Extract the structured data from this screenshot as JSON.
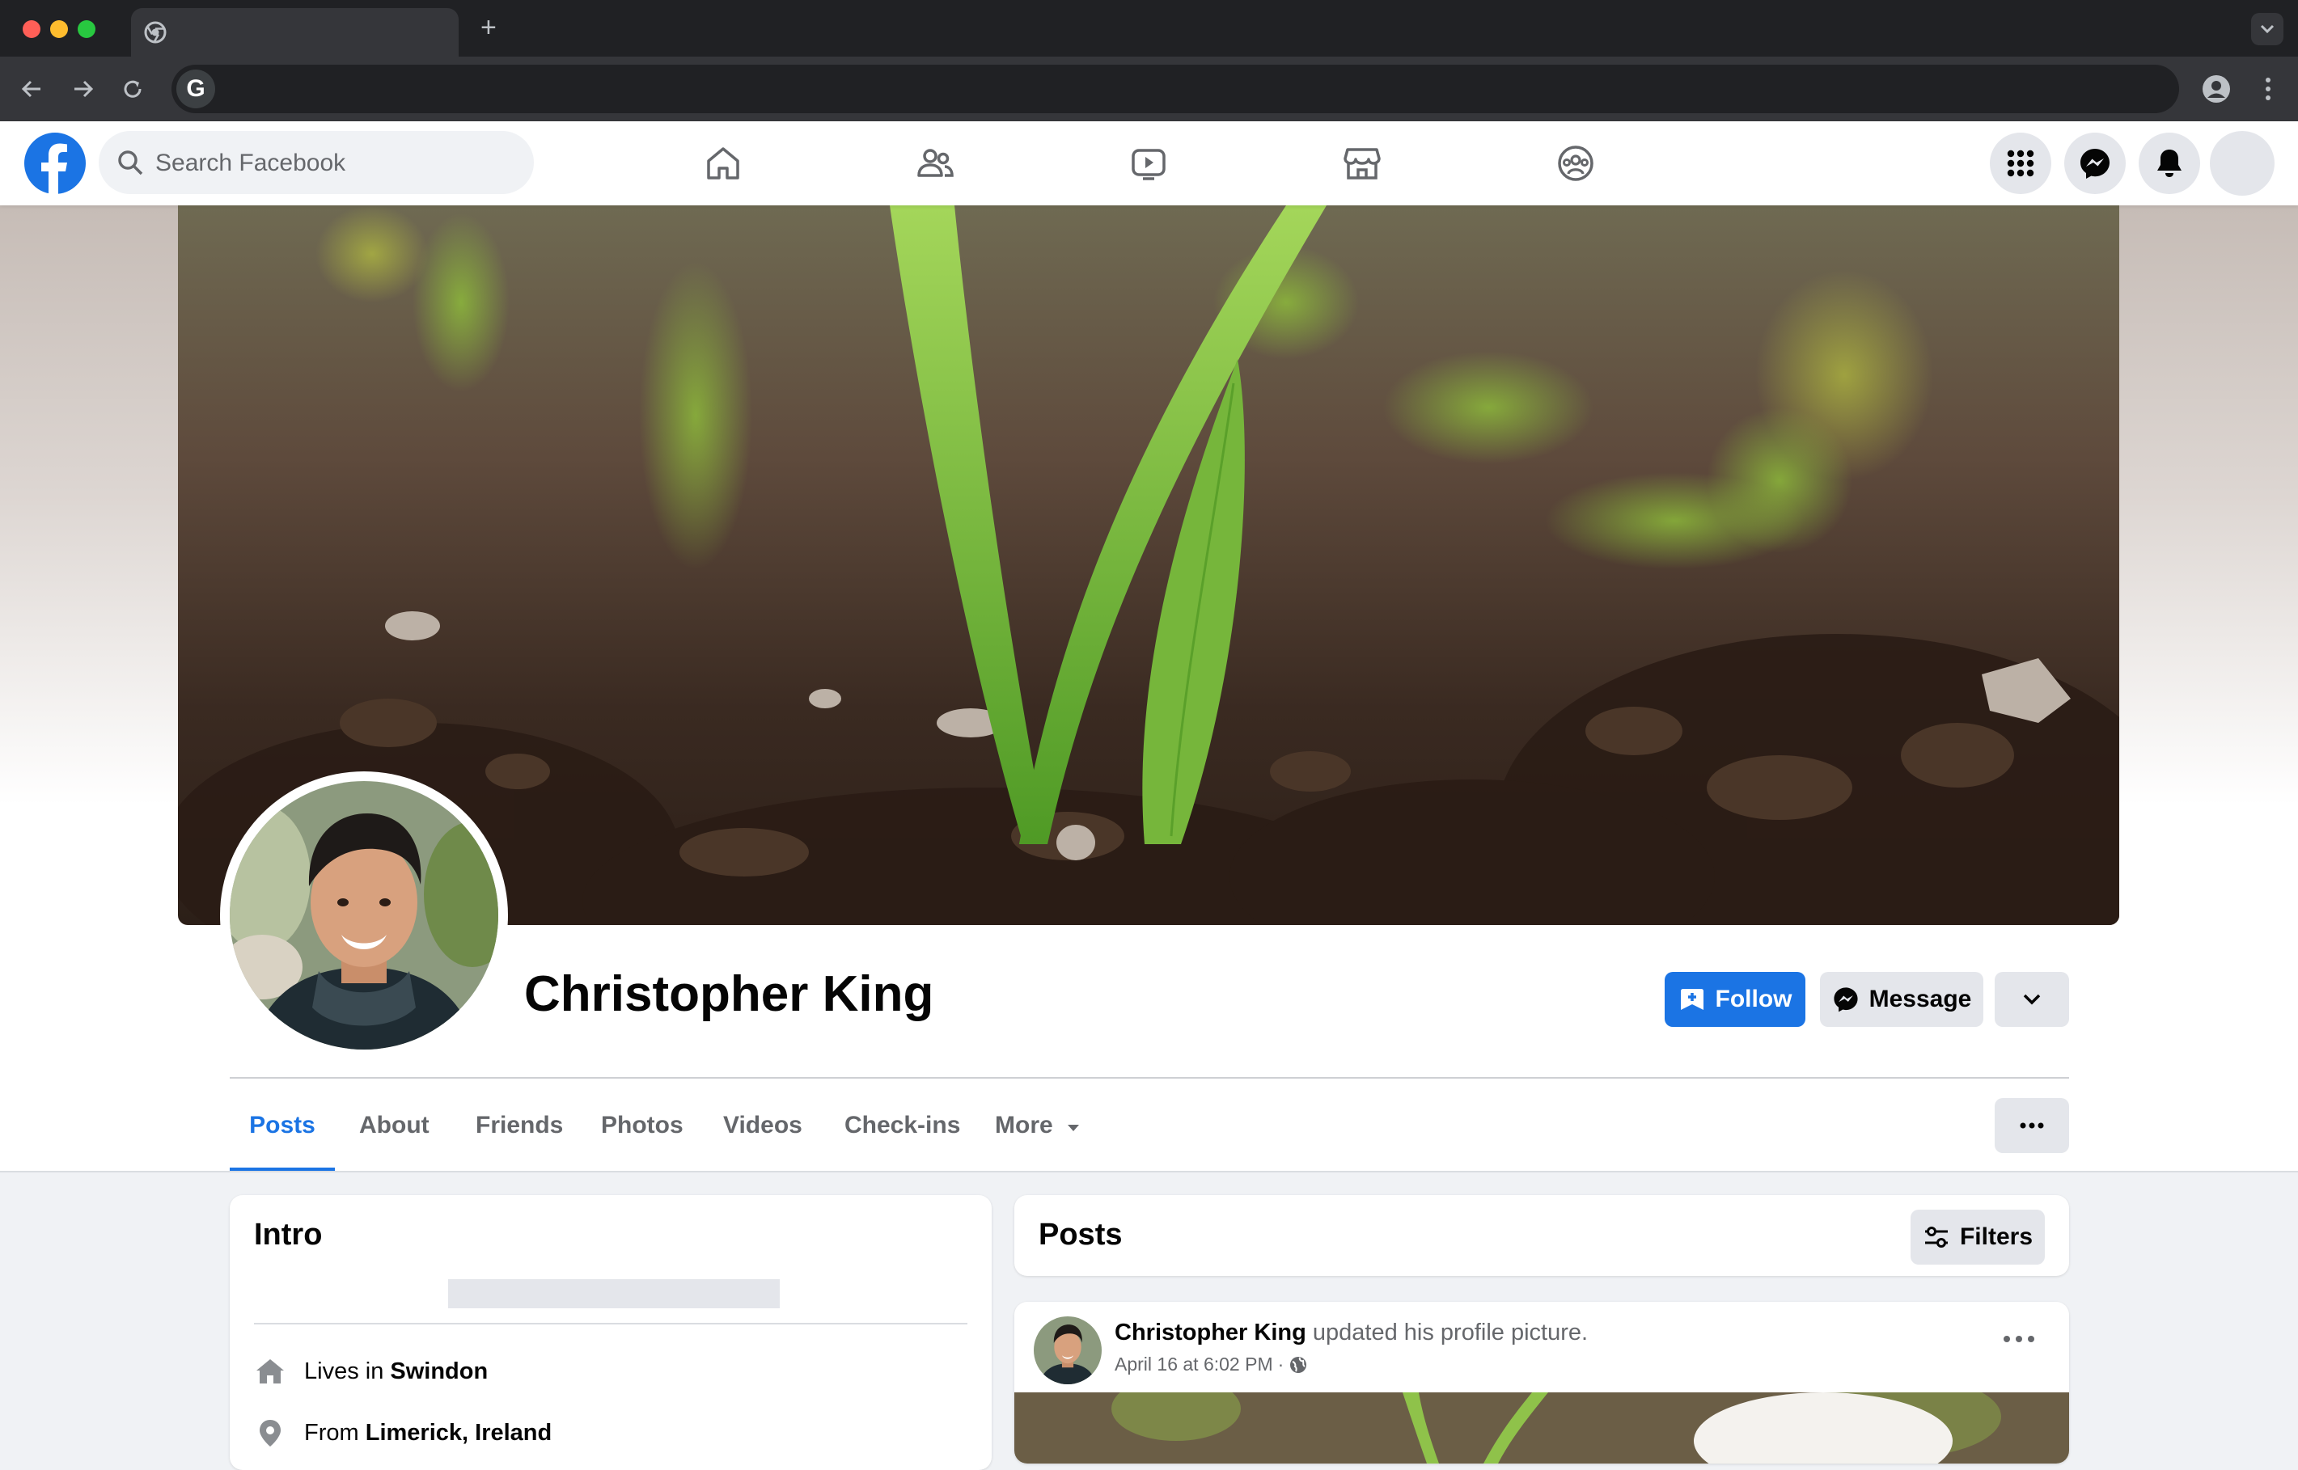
{
  "colors": {
    "brand": "#1b74e4",
    "chrome_dark": "#202124",
    "chrome_bar": "#35363a",
    "traffic_close": "#ff5f57",
    "traffic_min": "#febc2e",
    "traffic_max": "#28c840"
  },
  "browser": {
    "omnibox_badge": "G",
    "icons": [
      "chrome-icon",
      "plus-icon",
      "chevron-down-icon",
      "back-icon",
      "forward-icon",
      "reload-icon",
      "account-icon",
      "kebab-icon"
    ]
  },
  "header": {
    "search_placeholder": "Search Facebook",
    "nav_icons": [
      "home-icon",
      "friends-icon",
      "watch-icon",
      "marketplace-icon",
      "groups-icon"
    ],
    "right_icons": [
      "menu-grid-icon",
      "messenger-icon",
      "bell-icon",
      "avatar"
    ]
  },
  "profile": {
    "name": "Christopher King",
    "follow_label": "Follow",
    "message_label": "Message"
  },
  "tabs": [
    {
      "label": "Posts",
      "active": true
    },
    {
      "label": "About"
    },
    {
      "label": "Friends"
    },
    {
      "label": "Photos"
    },
    {
      "label": "Videos"
    },
    {
      "label": "Check-ins"
    },
    {
      "label": "More"
    }
  ],
  "intro": {
    "title": "Intro",
    "lives_prefix": "Lives in",
    "lives_place": "Swindon",
    "from_prefix": "From",
    "from_place": "Limerick, Ireland"
  },
  "posts": {
    "title": "Posts",
    "filters_label": "Filters",
    "first": {
      "author": "Christopher King",
      "action": "updated his profile picture.",
      "timestamp": "April 16 at 6:02 PM",
      "dot": "·"
    }
  }
}
